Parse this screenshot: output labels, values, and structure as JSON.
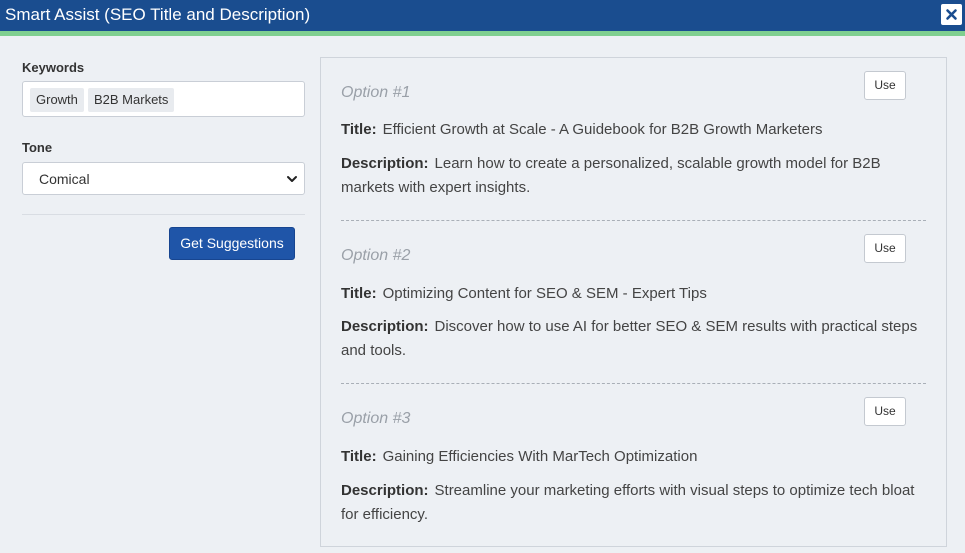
{
  "dialog": {
    "title": "Smart Assist (SEO Title and Description)",
    "close_icon": "close-icon"
  },
  "form": {
    "keywords_label": "Keywords",
    "keywords": [
      "Growth",
      "B2B Markets"
    ],
    "tone_label": "Tone",
    "tone_value": "Comical",
    "submit_label": "Get Suggestions"
  },
  "options": [
    {
      "heading": "Option #1",
      "use_label": "Use",
      "title_label": "Title:",
      "title": "Efficient Growth at Scale - A Guidebook for B2B Growth Marketers",
      "description_label": "Description:",
      "description": "Learn how to create a personalized, scalable growth model for B2B markets with expert insights."
    },
    {
      "heading": "Option #2",
      "use_label": "Use",
      "title_label": "Title:",
      "title": "Optimizing Content for SEO & SEM - Expert Tips",
      "description_label": "Description:",
      "description": "Discover how to use AI for better SEO & SEM results with practical steps and tools."
    },
    {
      "heading": "Option #3",
      "use_label": "Use",
      "title_label": "Title:",
      "title": "Gaining Efficiencies With MarTech Optimization",
      "description_label": "Description:",
      "description": "Streamline your marketing efforts with visual steps to optimize tech bloat for efficiency."
    }
  ],
  "colors": {
    "titlebar": "#1a4d8f",
    "accent_strip": "#7fcf8f",
    "primary_button": "#1f55a8"
  }
}
